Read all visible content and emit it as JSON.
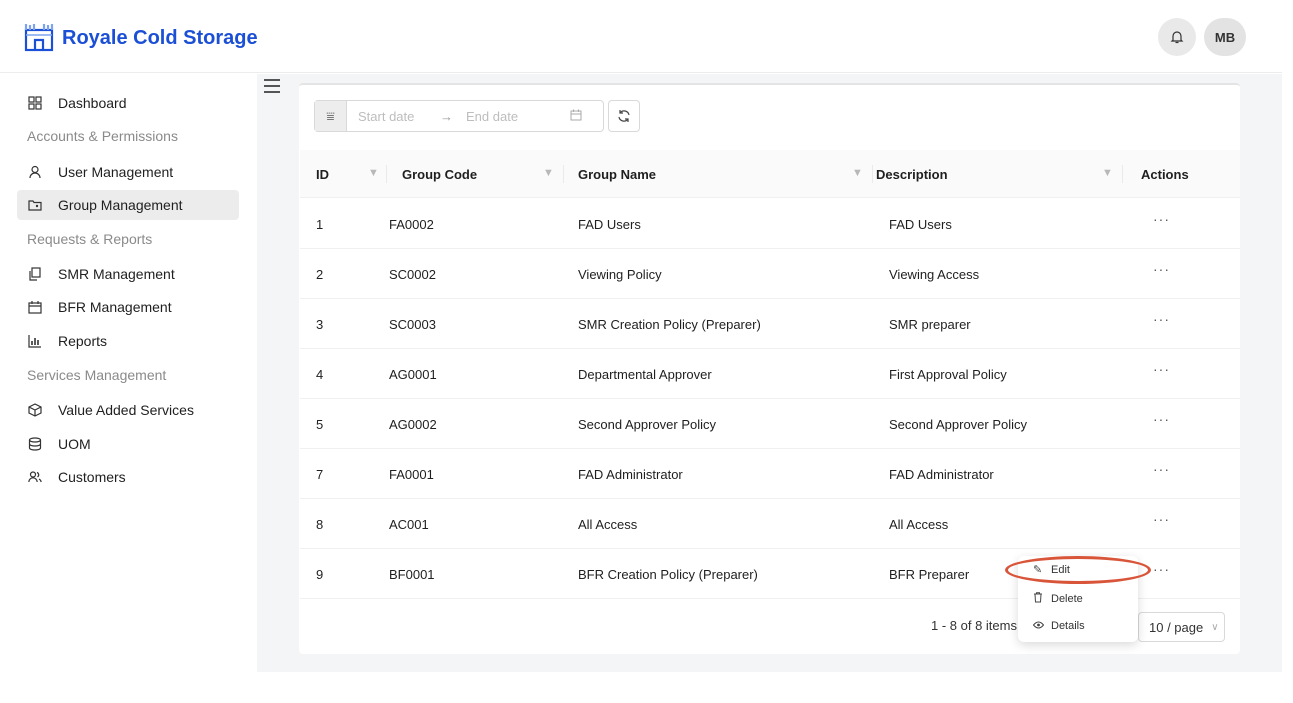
{
  "header": {
    "brand": "Royale Cold Storage",
    "avatar_initials": "MB",
    "icons": {
      "logo": "castle-logo",
      "bell": "bell-icon"
    },
    "brand_color": "#1b4fd6"
  },
  "sidebar": {
    "items": [
      {
        "label": "Dashboard",
        "icon": "dashboard-icon"
      },
      {
        "label": "User Management",
        "icon": "user-icon"
      },
      {
        "label": "Group Management",
        "icon": "folder-user-icon",
        "active": true
      },
      {
        "label": "SMR Management",
        "icon": "copy-icon"
      },
      {
        "label": "BFR Management",
        "icon": "calendar-icon"
      },
      {
        "label": "Reports",
        "icon": "bar-chart-icon"
      },
      {
        "label": "Value Added Services",
        "icon": "box-icon"
      },
      {
        "label": "UOM",
        "icon": "database-icon"
      },
      {
        "label": "Customers",
        "icon": "users-icon"
      }
    ],
    "sections": [
      "Accounts & Permissions",
      "Requests & Reports",
      "Services Management"
    ]
  },
  "filter": {
    "start_placeholder": "Start date",
    "arrow": "→",
    "end_placeholder": "End date"
  },
  "table": {
    "columns": [
      "ID",
      "Group Code",
      "Group Name",
      "Description",
      "Actions"
    ],
    "rows": [
      {
        "id": "1",
        "code": "FA0002",
        "name": "FAD Users",
        "desc": "FAD Users"
      },
      {
        "id": "2",
        "code": "SC0002",
        "name": "Viewing Policy",
        "desc": "Viewing Access"
      },
      {
        "id": "3",
        "code": "SC0003",
        "name": "SMR Creation Policy (Preparer)",
        "desc": "SMR preparer"
      },
      {
        "id": "4",
        "code": "AG0001",
        "name": "Departmental Approver",
        "desc": "First Approval Policy"
      },
      {
        "id": "5",
        "code": "AG0002",
        "name": "Second Approver Policy",
        "desc": "Second Approver Policy"
      },
      {
        "id": "7",
        "code": "FA0001",
        "name": "FAD Administrator",
        "desc": "FAD Administrator"
      },
      {
        "id": "8",
        "code": "AC001",
        "name": "All Access",
        "desc": "All Access"
      },
      {
        "id": "9",
        "code": "BF0001",
        "name": "BFR Creation Policy (Preparer)",
        "desc": "BFR Preparer"
      }
    ],
    "actions_glyph": "···"
  },
  "pagination": {
    "summary": "1 - 8 of 8 items",
    "page_size": "10 / page"
  },
  "dropdown": {
    "items": [
      {
        "label": "Edit",
        "icon": "edit-icon"
      },
      {
        "label": "Delete",
        "icon": "trash-icon"
      },
      {
        "label": "Details",
        "icon": "eye-icon"
      }
    ]
  },
  "accent_colors": {
    "highlight": "#d9553a"
  }
}
